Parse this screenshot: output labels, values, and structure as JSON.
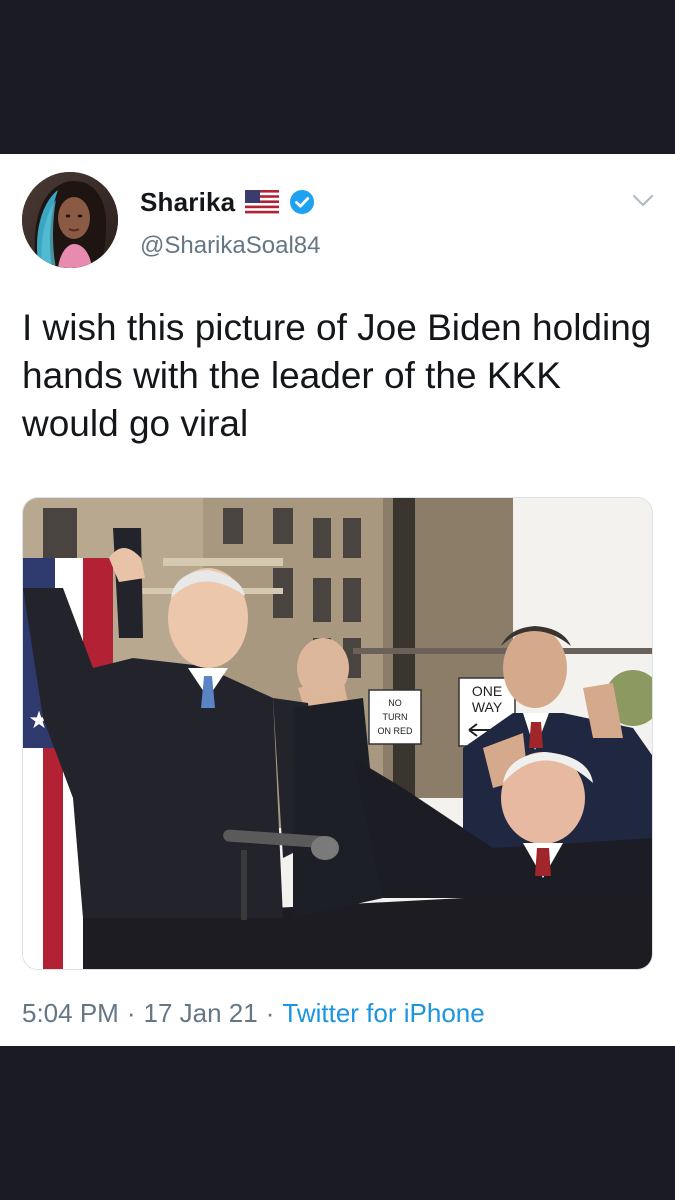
{
  "tweet": {
    "display_name": "Sharika",
    "handle": "@SharikaSoal84",
    "text": "I wish this picture of Joe Biden holding hands with the leader of the KKK would go viral",
    "time": "5:04 PM",
    "separator": "·",
    "date": "17 Jan 21",
    "source": "Twitter for iPhone"
  },
  "media": {
    "signs": {
      "no_turn_1": "NO",
      "no_turn_2": "TURN",
      "no_turn_3": "ON RED",
      "one_way_1": "ONE",
      "one_way_2": "WAY"
    }
  },
  "icons": {
    "flag": "us-flag-icon",
    "verified": "verified-badge-icon",
    "menu": "chevron-down-icon"
  },
  "colors": {
    "name": "#14171a",
    "secondary": "#657786",
    "link": "#1b95e0",
    "verified": "#1da1f2",
    "background_frame": "#1b1b25"
  }
}
